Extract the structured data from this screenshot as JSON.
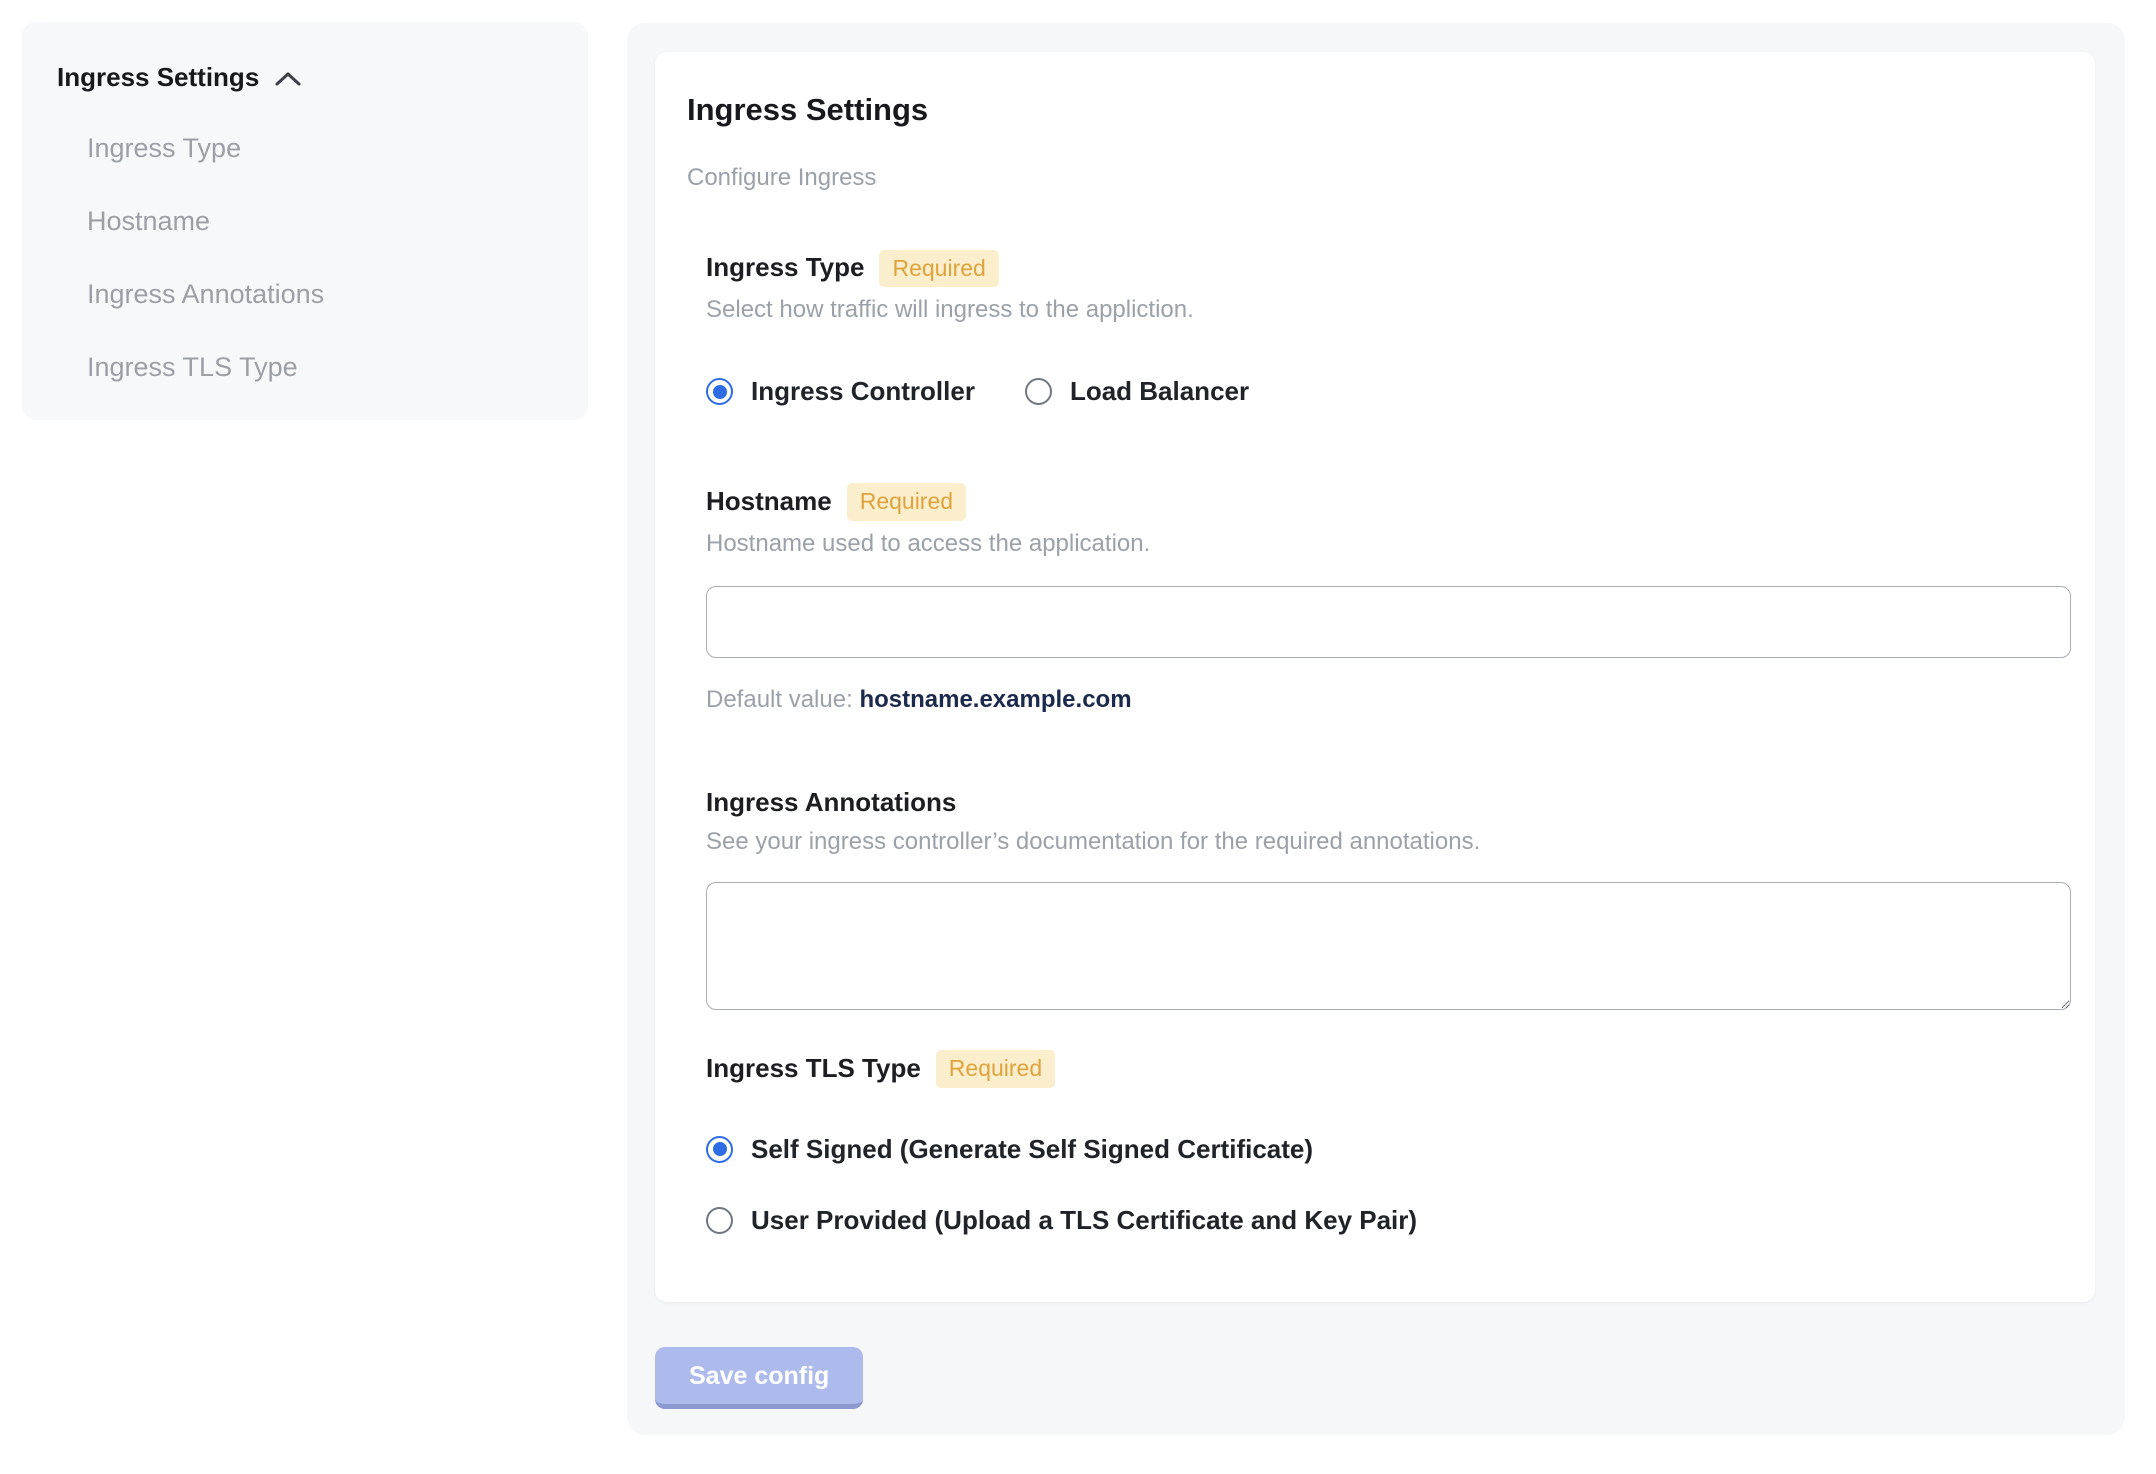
{
  "sidebar": {
    "header": "Ingress Settings",
    "collapse_icon": "chevron-up-icon",
    "items": [
      {
        "label": "Ingress Type"
      },
      {
        "label": "Hostname"
      },
      {
        "label": "Ingress Annotations"
      },
      {
        "label": "Ingress TLS Type"
      }
    ]
  },
  "main": {
    "title": "Ingress Settings",
    "subtitle": "Configure Ingress",
    "required_label": "Required",
    "sections": {
      "ingress_type": {
        "heading": "Ingress Type",
        "required": true,
        "helper": "Select how traffic will ingress to the appliction.",
        "options": [
          {
            "label": "Ingress Controller",
            "selected": true
          },
          {
            "label": "Load Balancer",
            "selected": false
          }
        ]
      },
      "hostname": {
        "heading": "Hostname",
        "required": true,
        "helper": "Hostname used to access the application.",
        "input_value": "",
        "input_placeholder": "",
        "default_value_label": "Default value:",
        "default_value": "hostname.example.com"
      },
      "annotations": {
        "heading": "Ingress Annotations",
        "required": false,
        "helper": "See your ingress controller’s documentation for the required annotations.",
        "textarea_value": ""
      },
      "tls": {
        "heading": "Ingress TLS Type",
        "required": true,
        "options": [
          {
            "label": "Self Signed (Generate Self Signed Certificate)",
            "selected": true
          },
          {
            "label": "User Provided (Upload a TLS Certificate and Key Pair)",
            "selected": false
          }
        ]
      }
    },
    "save_button": "Save config"
  },
  "colors": {
    "accent_blue": "#2e6ce6",
    "badge_bg": "#fbeecd",
    "badge_text": "#dfa33c",
    "default_value_text": "#1b2a4c",
    "button_bg": "#adbaec",
    "button_edge": "#8c99cf",
    "panel_bg": "#f6f7f9",
    "muted_text": "#9ba1a9"
  }
}
